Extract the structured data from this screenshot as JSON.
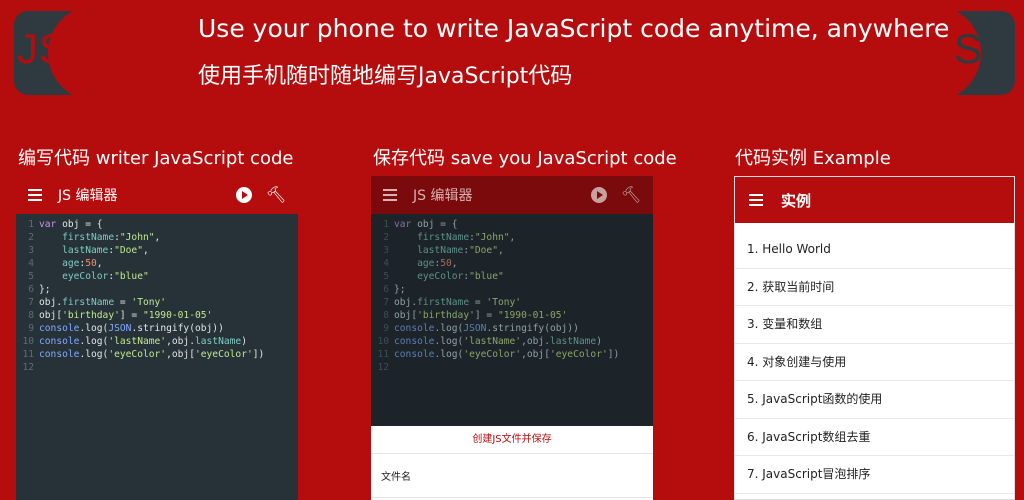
{
  "logo": {
    "text_j": "J",
    "text_se": "SE"
  },
  "header": {
    "headline": "Use your phone to write JavaScript code anytime, anywhere",
    "headline_cn": "使用手机随时随地编写JavaScript代码"
  },
  "sections": [
    {
      "label": "编写代码 writer JavaScript code"
    },
    {
      "label": "保存代码 save you JavaScript code"
    },
    {
      "label": "代码实例 Example"
    }
  ],
  "editor": {
    "title": "JS 编辑器",
    "icons": {
      "menu": "menu-icon",
      "run": "play-circle-icon",
      "build": "hammer-icon"
    },
    "lines": [
      {
        "n": "1",
        "code": "var obj = {"
      },
      {
        "n": "2",
        "code": "    firstName:\"John\","
      },
      {
        "n": "3",
        "code": "    lastName:\"Doe\","
      },
      {
        "n": "4",
        "code": "    age:50,"
      },
      {
        "n": "5",
        "code": "    eyeColor:\"blue\""
      },
      {
        "n": "6",
        "code": "};"
      },
      {
        "n": "7",
        "code": "obj.firstName = 'Tony'"
      },
      {
        "n": "8",
        "code": "obj['birthday'] = \"1990-01-05'"
      },
      {
        "n": "9",
        "code": "console.log(JSON.stringify(obj))"
      },
      {
        "n": "10",
        "code": "console.log('lastName',obj.lastName)"
      },
      {
        "n": "11",
        "code": "console.log('eyeColor',obj['eyeColor'])"
      },
      {
        "n": "12",
        "code": ""
      }
    ]
  },
  "save_dialog": {
    "title": "创建JS文件并保存",
    "field_label": "文件名"
  },
  "examples": {
    "title": "实例",
    "items": [
      "1. Hello World",
      "2. 获取当前时间",
      "3. 变量和数组",
      "4. 对象创建与使用",
      "5. JavaScript函数的使用",
      "6. JavaScript数组去重",
      "7. JavaScript冒泡排序"
    ]
  },
  "colors": {
    "brand_red": "#b50d0e",
    "editor_bg": "#263238",
    "logo_dark": "#2e3a40"
  }
}
